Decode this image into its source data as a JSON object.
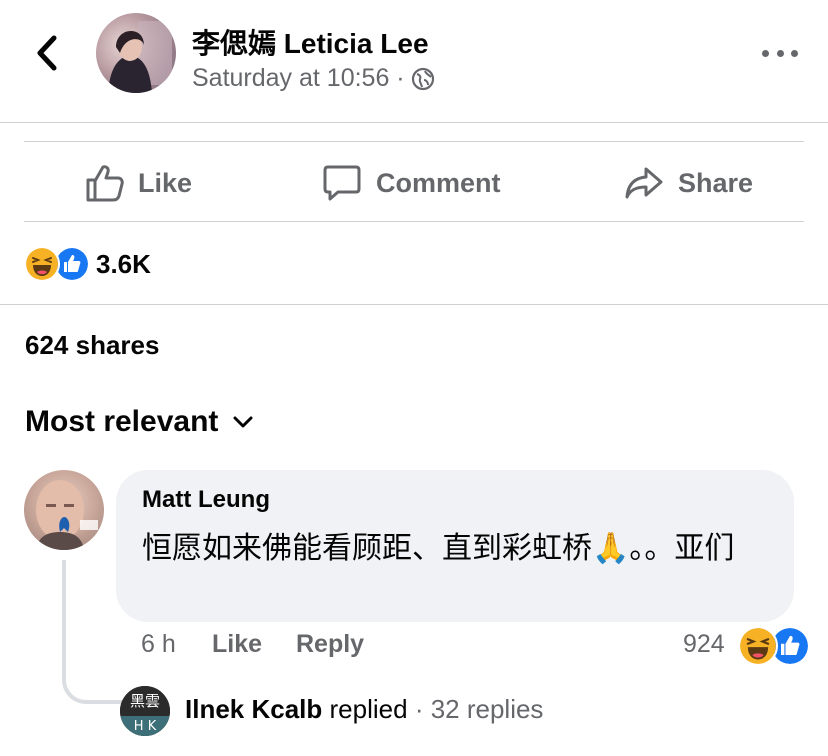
{
  "header": {
    "page_name": "李偲嫣 Leticia Lee",
    "timestamp": "Saturday at 10:56 ·"
  },
  "actions": {
    "like": "Like",
    "comment": "Comment",
    "share": "Share"
  },
  "reactions": {
    "count": "3.6K",
    "icons": [
      "haha-reaction-icon",
      "like-reaction-icon"
    ]
  },
  "shares": "624 shares",
  "sort": {
    "label": "Most relevant"
  },
  "comment": {
    "author": "Matt Leung",
    "text": "恒愿如来佛能看顾距、直到彩虹桥🙏。。亚们",
    "time": "6 h",
    "like": "Like",
    "reply": "Reply",
    "reaction_count": "924"
  },
  "reply_thread": {
    "author": "Ilnek Kcalb",
    "replied": "replied",
    "replies": "· 32 replies",
    "avatar_text": "黑雲 H K"
  },
  "colors": {
    "secondary_text": "#65676b",
    "bubble": "#f0f2f5",
    "like_blue": "#1877f2",
    "haha_yellow": "#f7b125"
  }
}
